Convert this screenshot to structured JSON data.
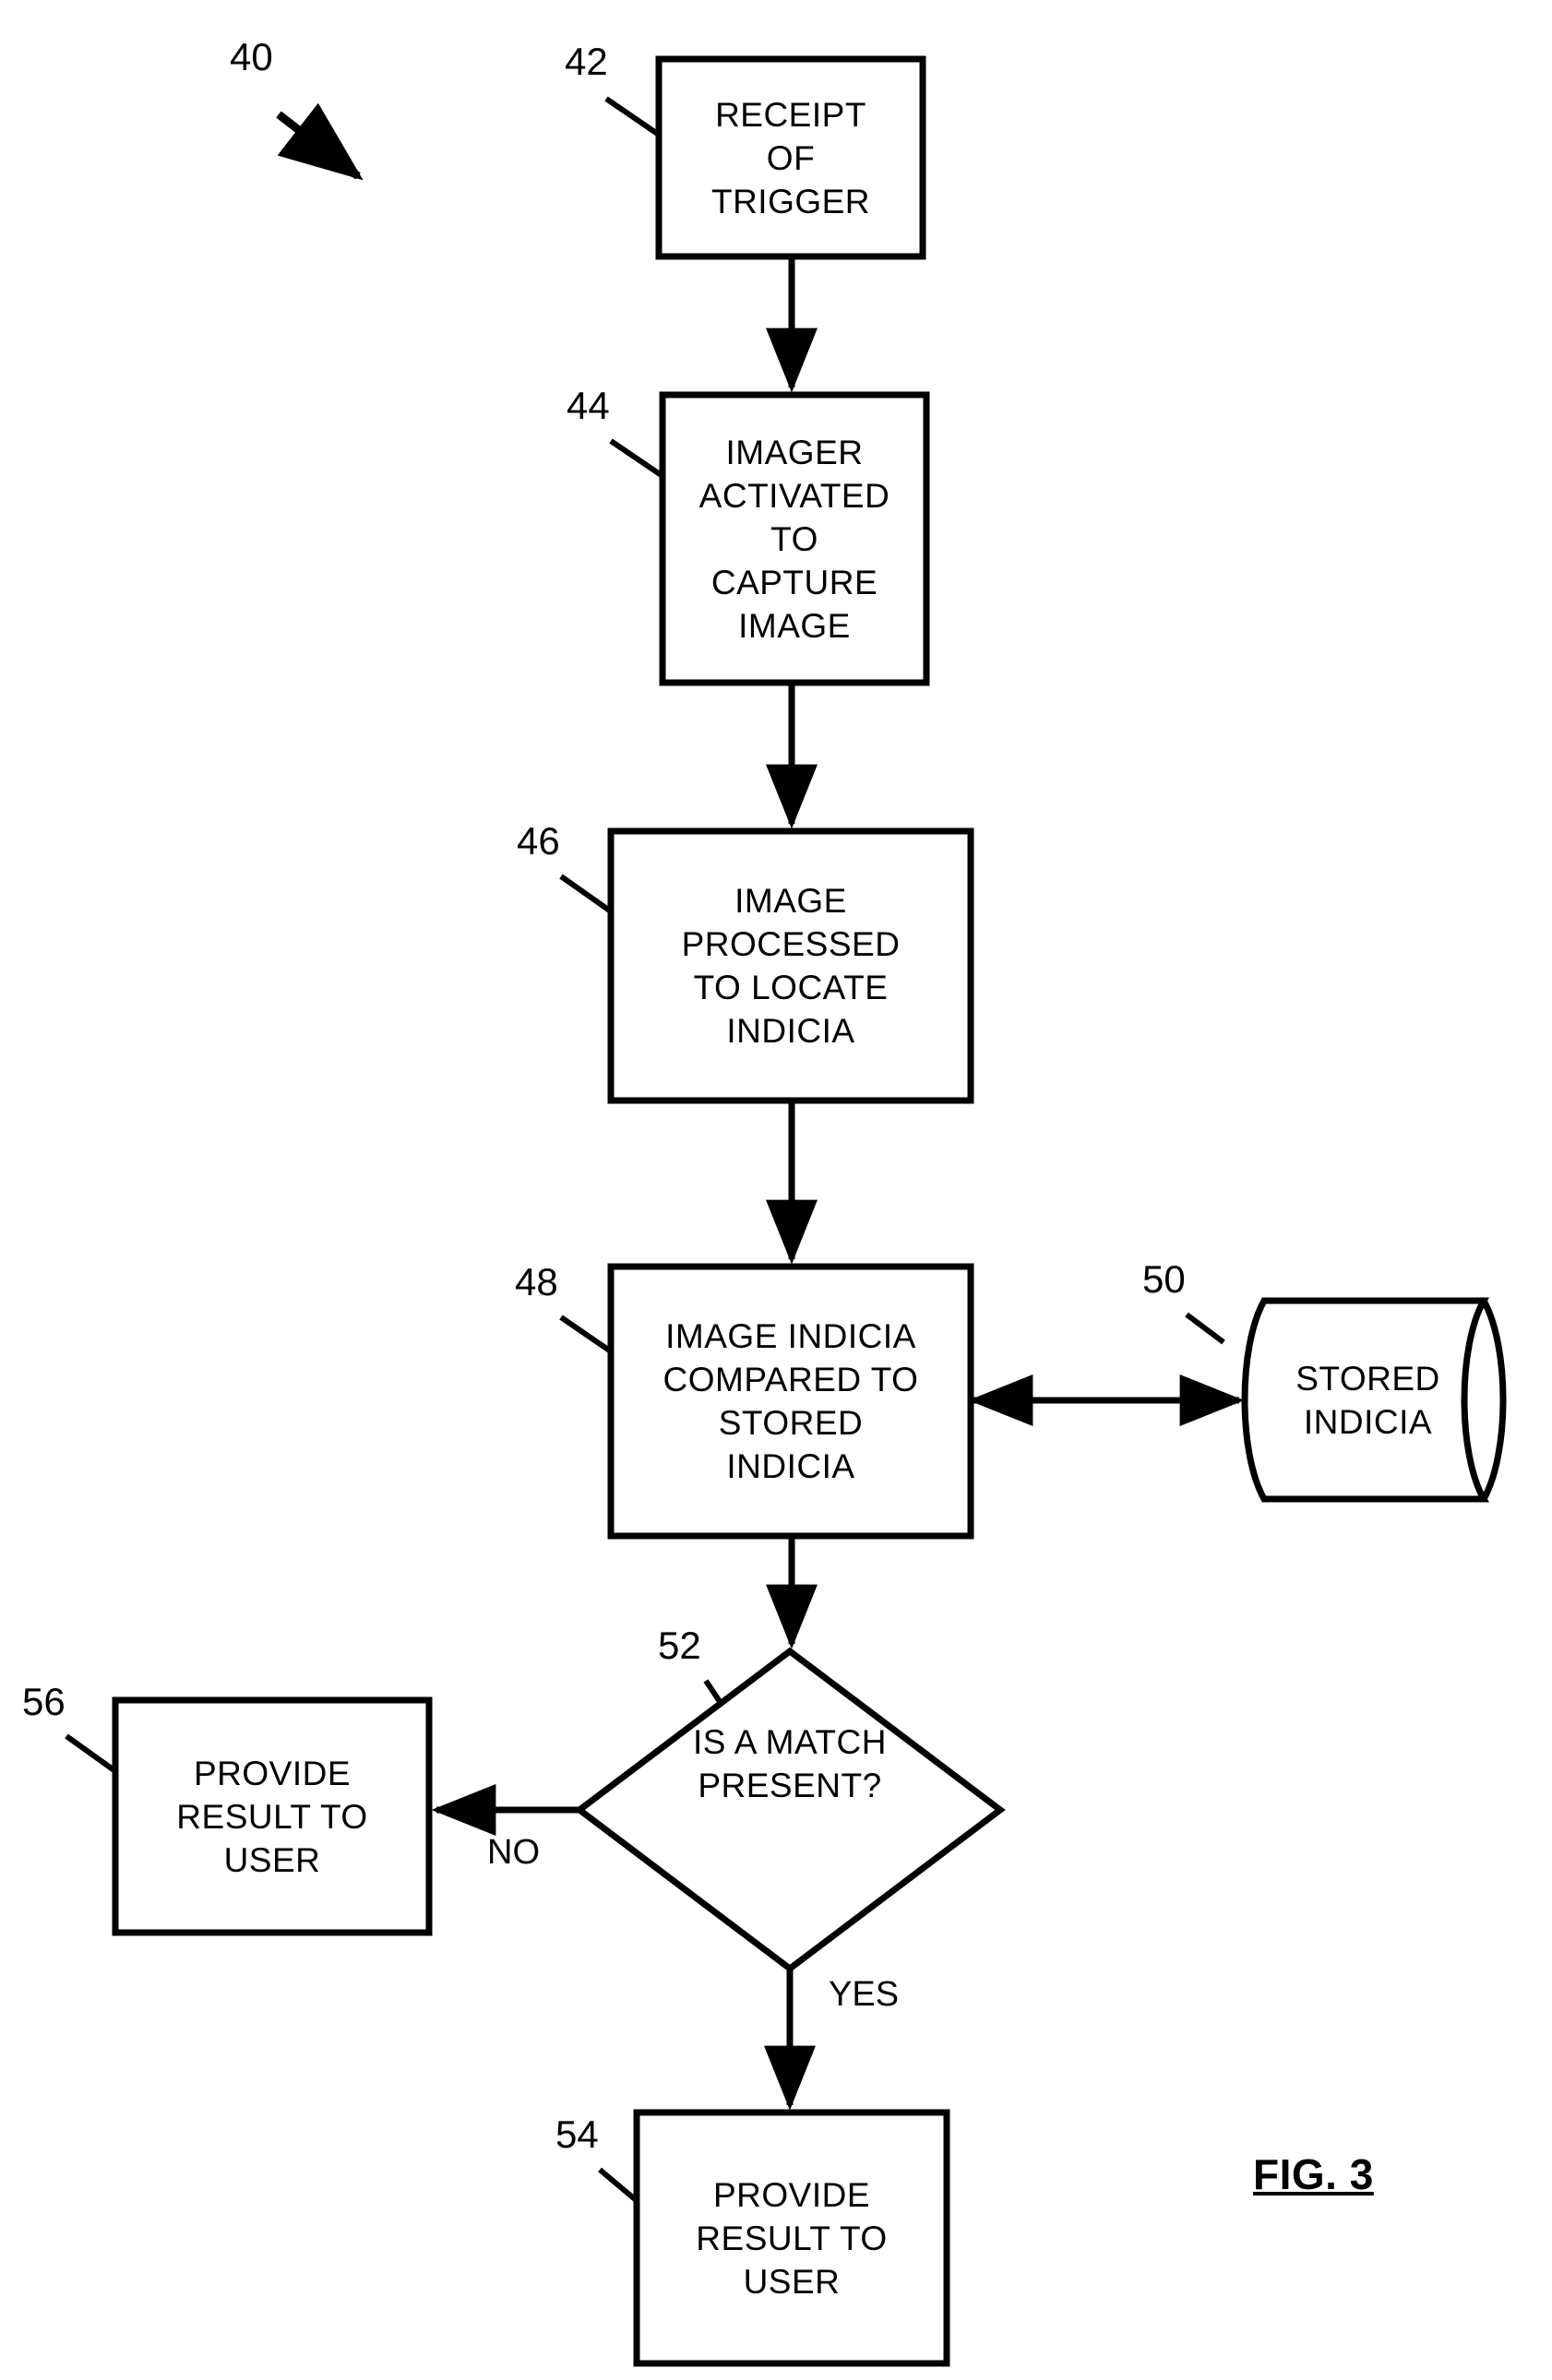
{
  "figure": {
    "caption": "FIG. 3",
    "diagram_ref": "40"
  },
  "nodes": [
    {
      "id": "n42",
      "ref": "42",
      "shape": "process",
      "text": "RECEIPT\nOF\nTRIGGER"
    },
    {
      "id": "n44",
      "ref": "44",
      "shape": "process",
      "text": "IMAGER\nACTIVATED\nTO\nCAPTURE\nIMAGE"
    },
    {
      "id": "n46",
      "ref": "46",
      "shape": "process",
      "text": "IMAGE\nPROCESSED\nTO LOCATE\nINDICIA"
    },
    {
      "id": "n48",
      "ref": "48",
      "shape": "process",
      "text": "IMAGE INDICIA\nCOMPARED TO\nSTORED\nINDICIA"
    },
    {
      "id": "n50",
      "ref": "50",
      "shape": "database-cylinder",
      "text": "STORED\nINDICIA"
    },
    {
      "id": "n52",
      "ref": "52",
      "shape": "decision-diamond",
      "text": "IS A MATCH\nPRESENT?"
    },
    {
      "id": "n54",
      "ref": "54",
      "shape": "process",
      "text": "PROVIDE\nRESULT TO\nUSER"
    },
    {
      "id": "n56",
      "ref": "56",
      "shape": "process",
      "text": "PROVIDE\nRESULT TO\nUSER"
    }
  ],
  "edges": [
    {
      "id": "e42_44",
      "from": "42",
      "to": "44",
      "label": ""
    },
    {
      "id": "e44_46",
      "from": "44",
      "to": "46",
      "label": ""
    },
    {
      "id": "e46_48",
      "from": "46",
      "to": "48",
      "label": ""
    },
    {
      "id": "e48_50",
      "from": "48",
      "to": "50",
      "label": "",
      "bidirectional": true
    },
    {
      "id": "e48_52",
      "from": "48",
      "to": "52",
      "label": ""
    },
    {
      "id": "e52_56",
      "from": "52",
      "to": "56",
      "label": "NO"
    },
    {
      "id": "e52_54",
      "from": "52",
      "to": "54",
      "label": "YES"
    }
  ],
  "colors": {
    "stroke": "#000000",
    "background": "#ffffff"
  }
}
